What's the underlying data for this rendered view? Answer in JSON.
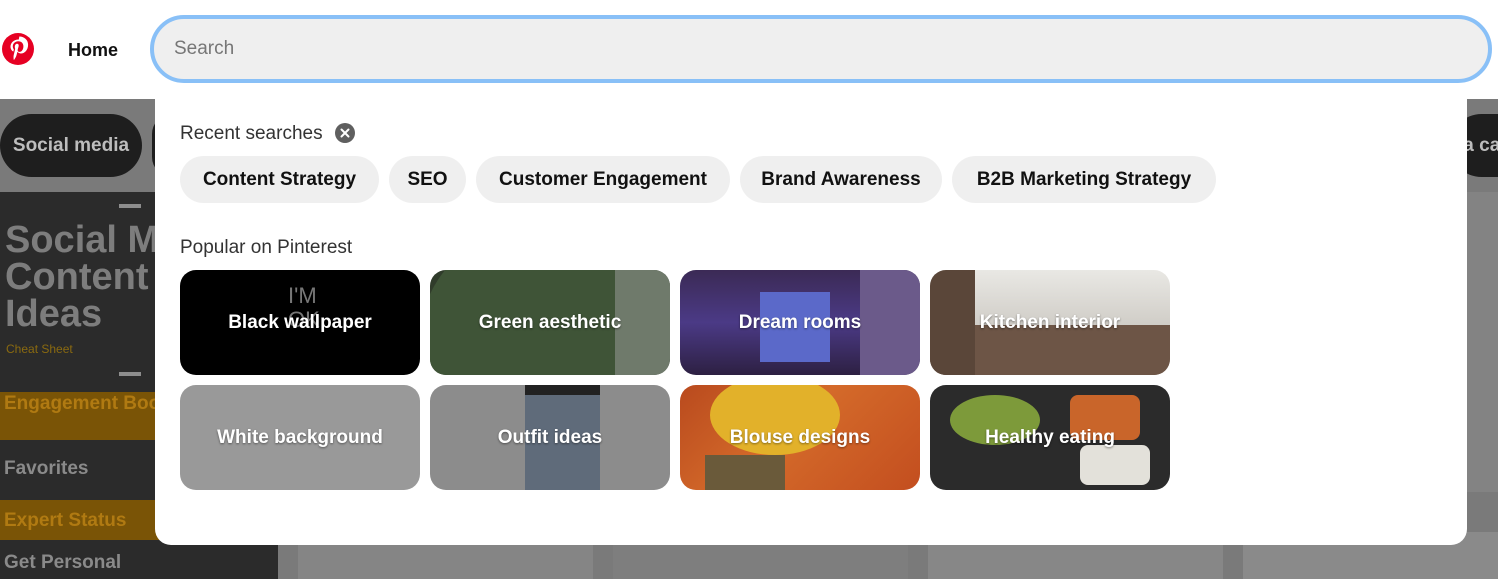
{
  "header": {
    "logo_icon": "pinterest-logo-icon",
    "home_label": "Home",
    "search_placeholder": "Search",
    "search_value": ""
  },
  "background": {
    "chips": [
      "Social media",
      "ia ca"
    ],
    "big_card": {
      "title": "Social M\nContent\nIdeas",
      "subtitle": "Cheat Sheet",
      "sections": [
        "Engagement Boosts",
        "Favorites",
        "Expert Status",
        "Get Personal"
      ]
    }
  },
  "dropdown": {
    "recent_title": "Recent searches",
    "clear_icon": "close-circle-icon",
    "recent_searches": [
      "Content Strategy",
      "SEO",
      "Customer Engagement",
      "Brand Awareness",
      "B2B Marketing Strategy"
    ],
    "popular_title": "Popular on Pinterest",
    "popular": [
      {
        "label": "Black wallpaper"
      },
      {
        "label": "Green aesthetic"
      },
      {
        "label": "Dream rooms"
      },
      {
        "label": "Kitchen interior"
      },
      {
        "label": "White background"
      },
      {
        "label": "Outfit ideas"
      },
      {
        "label": "Blouse designs"
      },
      {
        "label": "Healthy eating"
      }
    ]
  },
  "colors": {
    "brand": "#e60023",
    "focus_ring": "#89c0f7",
    "chip_bg": "#efefef",
    "overlay": "#7a7a7a"
  }
}
